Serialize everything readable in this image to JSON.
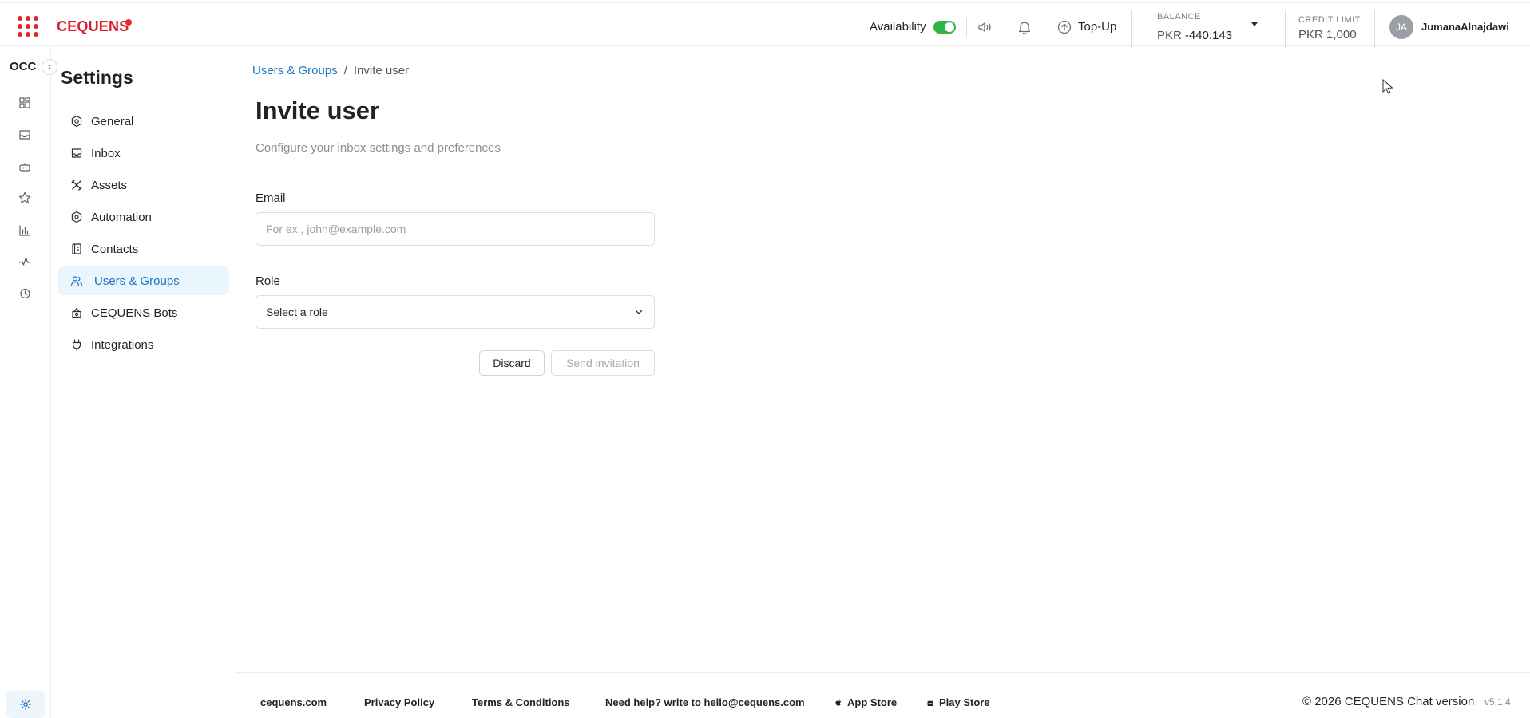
{
  "brand": {
    "logo_text": "CEQUENS",
    "accent": "#e02a33",
    "link_color": "#1a73c7"
  },
  "header": {
    "availability_label": "Availability",
    "availability_on": true,
    "topup_label": "Top-Up",
    "balance": {
      "label": "BALANCE",
      "currency": "PKR",
      "amount": "-440.143"
    },
    "credit_limit": {
      "label": "CREDIT LIMIT",
      "value": "PKR 1,000"
    },
    "user": {
      "initials": "JA",
      "name": "JumanaAlnajdawi"
    },
    "icons": [
      "apps-grid-icon",
      "speaker-icon",
      "bell-icon",
      "arrow-up-circle-icon",
      "caret-down-icon"
    ]
  },
  "rail": {
    "title": "OCC",
    "expand_icon": "chevron-right-icon",
    "icons": [
      "dashboard-icon",
      "inbox-icon",
      "bot-icon",
      "star-icon",
      "bar-chart-icon",
      "activity-icon",
      "history-icon",
      "gear-icon"
    ]
  },
  "settings": {
    "title": "Settings",
    "nav": [
      {
        "label": "General",
        "icon": "gear-icon",
        "active": false
      },
      {
        "label": "Inbox",
        "icon": "inbox-icon",
        "active": false
      },
      {
        "label": "Assets",
        "icon": "tools-icon",
        "active": false
      },
      {
        "label": "Automation",
        "icon": "automation-icon",
        "active": false
      },
      {
        "label": "Contacts",
        "icon": "contacts-icon",
        "active": false
      },
      {
        "label": "Users & Groups",
        "icon": "users-icon",
        "active": true
      },
      {
        "label": "CEQUENS Bots",
        "icon": "bot-icon",
        "active": false
      },
      {
        "label": "Integrations",
        "icon": "plug-icon",
        "active": false
      }
    ]
  },
  "breadcrumb": {
    "parent": "Users & Groups",
    "separator": "/",
    "current": "Invite user"
  },
  "page": {
    "title": "Invite user",
    "subtitle": "Configure your inbox settings and preferences"
  },
  "form": {
    "email": {
      "label": "Email",
      "value": "",
      "placeholder": "For ex., john@example.com"
    },
    "role": {
      "label": "Role",
      "selected": "Select a role"
    },
    "discard_label": "Discard",
    "send_label": "Send invitation"
  },
  "footer": {
    "links": [
      "cequens.com",
      "Privacy Policy",
      "Terms & Conditions",
      "Need help? write to hello@cequens.com",
      "App Store",
      "Play Store"
    ],
    "copyright": "© 2026 CEQUENS Chat version",
    "version": "v5.1.4"
  }
}
